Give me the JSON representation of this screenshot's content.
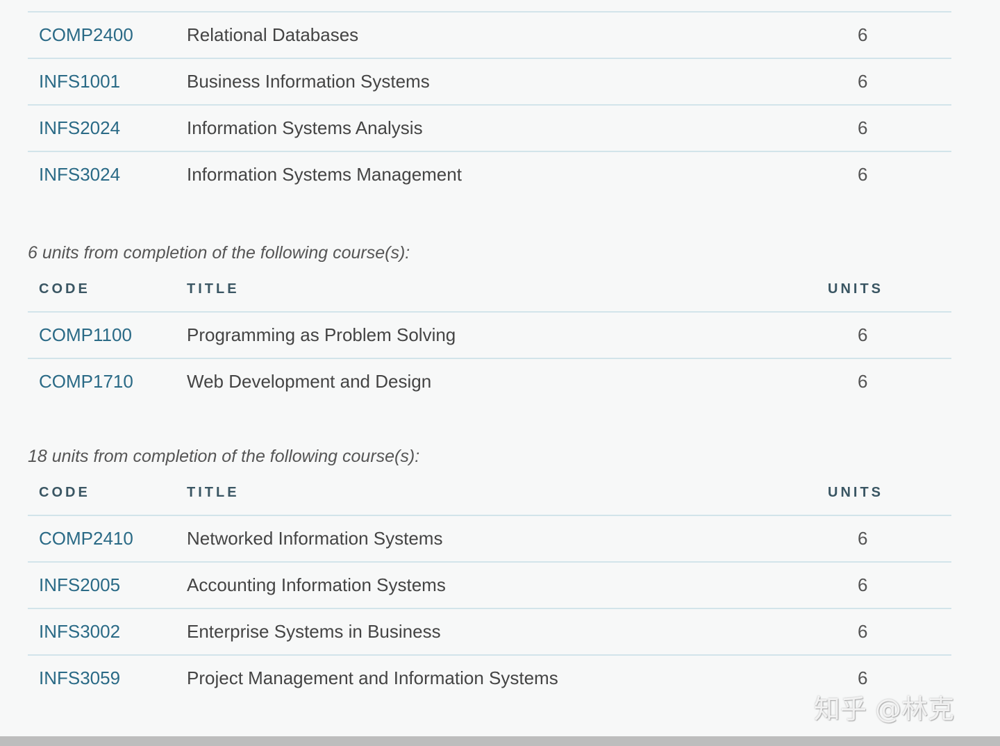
{
  "group1": {
    "rows": [
      {
        "code": "COMP2400",
        "title": "Relational Databases",
        "units": "6"
      },
      {
        "code": "INFS1001",
        "title": "Business Information Systems",
        "units": "6"
      },
      {
        "code": "INFS2024",
        "title": "Information Systems Analysis",
        "units": "6"
      },
      {
        "code": "INFS3024",
        "title": "Information Systems Management",
        "units": "6"
      }
    ]
  },
  "group2": {
    "requirement": "6 units from completion of the following course(s):",
    "headers": {
      "code": "CODE",
      "title": "TITLE",
      "units": "UNITS"
    },
    "rows": [
      {
        "code": "COMP1100",
        "title": "Programming as Problem Solving",
        "units": "6"
      },
      {
        "code": "COMP1710",
        "title": "Web Development and Design",
        "units": "6"
      }
    ]
  },
  "group3": {
    "requirement": "18 units from completion of the following course(s):",
    "headers": {
      "code": "CODE",
      "title": "TITLE",
      "units": "UNITS"
    },
    "rows": [
      {
        "code": "COMP2410",
        "title": "Networked Information Systems",
        "units": "6"
      },
      {
        "code": "INFS2005",
        "title": "Accounting Information Systems",
        "units": "6"
      },
      {
        "code": "INFS3002",
        "title": "Enterprise Systems in Business",
        "units": "6"
      },
      {
        "code": "INFS3059",
        "title": "Project Management and Information Systems",
        "units": "6"
      }
    ]
  },
  "watermark": "知乎 @林克"
}
